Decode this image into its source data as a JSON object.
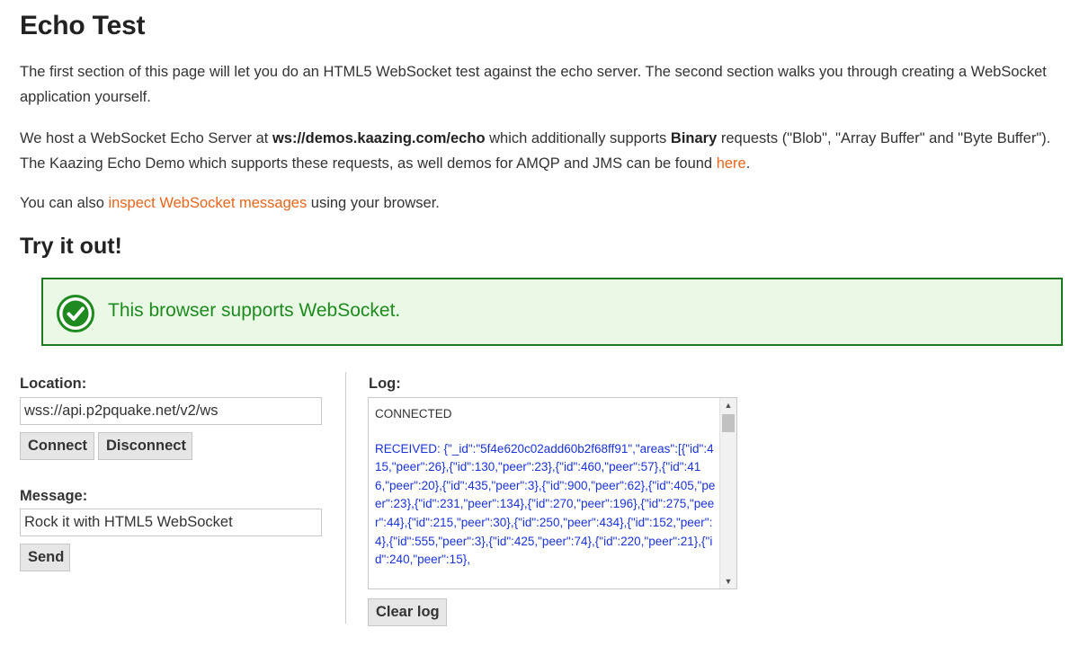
{
  "title": "Echo Test",
  "intro": {
    "text": "The first section of this page will let you do an HTML5 WebSocket test against the echo server. The second section walks you through creating a WebSocket application yourself."
  },
  "host_info": {
    "before": "We host a WebSocket Echo Server at ",
    "server_url": "ws://demos.kaazing.com/echo",
    "middle": " which additionally supports ",
    "binary": "Binary",
    "after": " requests (\"Blob\", \"Array Buffer\" and \"Byte Buffer\"). The Kaazing Echo Demo which supports these requests, as well demos for AMQP and JMS can be found ",
    "here_link": "here",
    "end": "."
  },
  "inspect_info": {
    "before": "You can also ",
    "link": "inspect WebSocket messages",
    "after": " using your browser."
  },
  "try_heading": "Try it out!",
  "support_message": "This browser supports WebSocket.",
  "location": {
    "label": "Location:",
    "value": "wss://api.p2pquake.net/v2/ws",
    "connect_label": "Connect",
    "disconnect_label": "Disconnect"
  },
  "message": {
    "label": "Message:",
    "value": "Rock it with HTML5 WebSocket",
    "send_label": "Send"
  },
  "log": {
    "label": "Log:",
    "connected": "CONNECTED",
    "received": "RECEIVED: {\"_id\":\"5f4e620c02add60b2f68ff91\",\"areas\":[{\"id\":415,\"peer\":26},{\"id\":130,\"peer\":23},{\"id\":460,\"peer\":57},{\"id\":416,\"peer\":20},{\"id\":435,\"peer\":3},{\"id\":900,\"peer\":62},{\"id\":405,\"peer\":23},{\"id\":231,\"peer\":134},{\"id\":270,\"peer\":196},{\"id\":275,\"peer\":44},{\"id\":215,\"peer\":30},{\"id\":250,\"peer\":434},{\"id\":152,\"peer\":4},{\"id\":555,\"peer\":3},{\"id\":425,\"peer\":74},{\"id\":220,\"peer\":21},{\"id\":240,\"peer\":15},",
    "clear_label": "Clear log"
  },
  "colors": {
    "link": "#e8651a",
    "success_border": "#1f7a1f",
    "success_text": "#1f8a1f",
    "success_bg": "#e9f9e5",
    "log_received": "#1a33d6"
  }
}
